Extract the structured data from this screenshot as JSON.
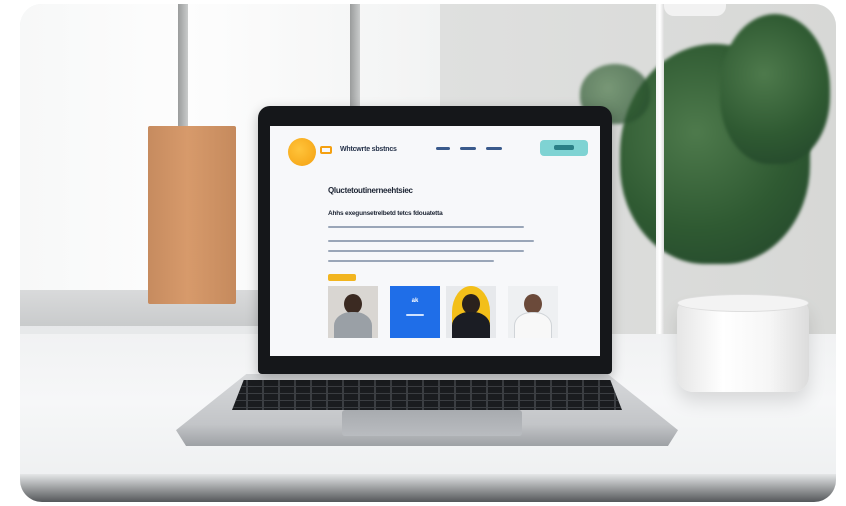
{
  "screen_site": {
    "brand": "Whtcwrte sbstncs",
    "hero_title": "Qluctetoutinerneehtsiec",
    "hero_subtitle": "Ahhs exegunsetrelbetd tetcs fdouatetta",
    "card_blue_label": "ak"
  },
  "colors": {
    "logo": "#f4a010",
    "accent_blue": "#1f6ee8",
    "cta": "#7fd3d3",
    "badge": "#f2b51f"
  },
  "icons": {
    "logo": "circle-logo-icon",
    "logo_mark": "chat-bubble-icon"
  }
}
